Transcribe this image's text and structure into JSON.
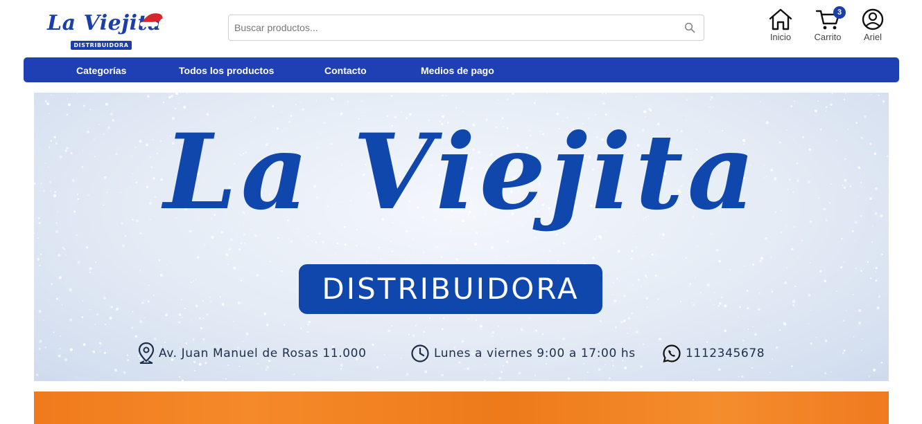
{
  "brand": {
    "logo_text": "La Viejita",
    "logo_subtitle": "DISTRIBUIDORA",
    "color": "#1f40b5"
  },
  "search": {
    "placeholder": "Buscar productos...",
    "value": "",
    "icon": "search-icon"
  },
  "header_nav": {
    "home_label": "Inicio",
    "cart_label": "Carrito",
    "cart_count": "3",
    "user_label": "Ariel"
  },
  "menu": {
    "items": [
      {
        "label": "Categorías"
      },
      {
        "label": "Todos los productos"
      },
      {
        "label": "Contacto"
      },
      {
        "label": "Medios de pago"
      }
    ]
  },
  "banner": {
    "title": "La Viejita",
    "badge": "DISTRIBUIDORA",
    "address": "Av. Juan Manuel de Rosas 11.000",
    "hours": "Lunes a viernes 9:00 a 17:00 hs",
    "phone": "1112345678",
    "title_color": "#0f47ad"
  },
  "next_banner": {
    "color": "#f07a1c"
  }
}
